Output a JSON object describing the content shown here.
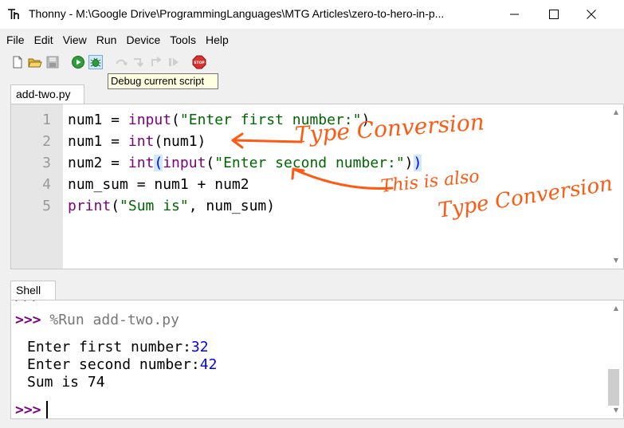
{
  "window": {
    "title": "Thonny  -  M:\\Google Drive\\ProgrammingLanguages\\MTG Articles\\zero-to-hero-in-p..."
  },
  "menu": [
    "File",
    "Edit",
    "View",
    "Run",
    "Device",
    "Tools",
    "Help"
  ],
  "toolbar": {
    "tooltip": "Debug current script"
  },
  "editor": {
    "tab_label": "add-two.py",
    "line_numbers": [
      "1",
      "2",
      "3",
      "4",
      "5"
    ],
    "code": {
      "l1_var": "num1 = ",
      "l1_fn": "input",
      "l1_open": "(",
      "l1_str": "\"Enter first number:\"",
      "l1_close": ")",
      "l2_var": "num1 = ",
      "l2_fn": "int",
      "l2_args": "(num1)",
      "l3_var": "num2 = ",
      "l3_fn1": "int",
      "l3_open1": "(",
      "l3_fn2": "input",
      "l3_open2": "(",
      "l3_str": "\"Enter second number:\"",
      "l3_close2": ")",
      "l3_close1": ")",
      "l4": "num_sum = num1 + num2",
      "l5_fn": "print",
      "l5_open": "(",
      "l5_str": "\"Sum is\"",
      "l5_rest": ", num_sum)"
    }
  },
  "shell": {
    "tab_label": "Shell",
    "prompt": ">>>",
    "run_cmd": "%Run add-two.py",
    "out1_label": "Enter first number:",
    "out1_value": "32",
    "out2_label": "Enter second number:",
    "out2_value": "42",
    "out3": "Sum is 74"
  },
  "annotations": {
    "note1": "Type Conversion",
    "note2a": "This is also",
    "note2b": "Type Conversion"
  },
  "colors": {
    "annotation": "#ff5a14",
    "keyword": "#7c007c",
    "string": "#006600",
    "user_input": "#0000ff"
  }
}
